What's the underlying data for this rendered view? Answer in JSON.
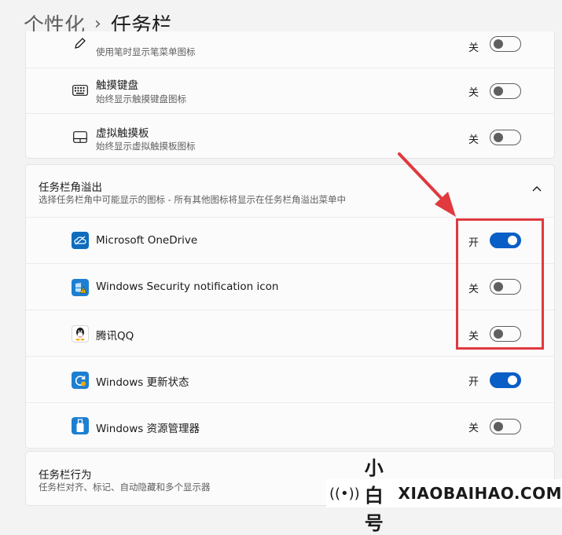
{
  "breadcrumb": {
    "parent": "个性化",
    "separator": "›",
    "current": "任务栏"
  },
  "pen_row": {
    "subtitle": "使用笔时显示笔菜单图标",
    "toggle_label": "关",
    "state": "off"
  },
  "touch_keyboard_row": {
    "title": "触摸键盘",
    "subtitle": "始终显示触摸键盘图标",
    "toggle_label": "关",
    "state": "off",
    "icon": "keyboard-icon"
  },
  "virtual_touchpad_row": {
    "title": "虚拟触摸板",
    "subtitle": "始终显示虚拟触摸板图标",
    "toggle_label": "关",
    "state": "off",
    "icon": "touchpad-icon"
  },
  "overflow_section": {
    "title": "任务栏角溢出",
    "description": "选择任务栏角中可能显示的图标 - 所有其他图标将显示在任务栏角溢出菜单中",
    "chevron": "^",
    "items": [
      {
        "label": "Microsoft OneDrive",
        "toggle_label": "开",
        "state": "on",
        "icon": "onedrive-icon"
      },
      {
        "label": "Windows Security notification icon",
        "toggle_label": "关",
        "state": "off",
        "icon": "windows-security-icon"
      },
      {
        "label": "腾讯QQ",
        "toggle_label": "关",
        "state": "off",
        "icon": "qq-icon"
      },
      {
        "label": "Windows 更新状态",
        "toggle_label": "开",
        "state": "on",
        "icon": "windows-update-icon"
      },
      {
        "label": "Windows 资源管理器",
        "toggle_label": "关",
        "state": "off",
        "icon": "usb-drive-icon"
      }
    ]
  },
  "behavior_section": {
    "title": "任务栏行为",
    "description": "任务栏对齐、标记、自动隐藏和多个显示器"
  },
  "watermark": {
    "symbol": "((•))",
    "name_cn": "小白号",
    "site": "XIAOBAIHAO.COM"
  },
  "colors": {
    "accent": "#0a5fc7",
    "annotation": "#e0393e",
    "background": "#f3f3f3",
    "card": "#fbfbfb"
  }
}
